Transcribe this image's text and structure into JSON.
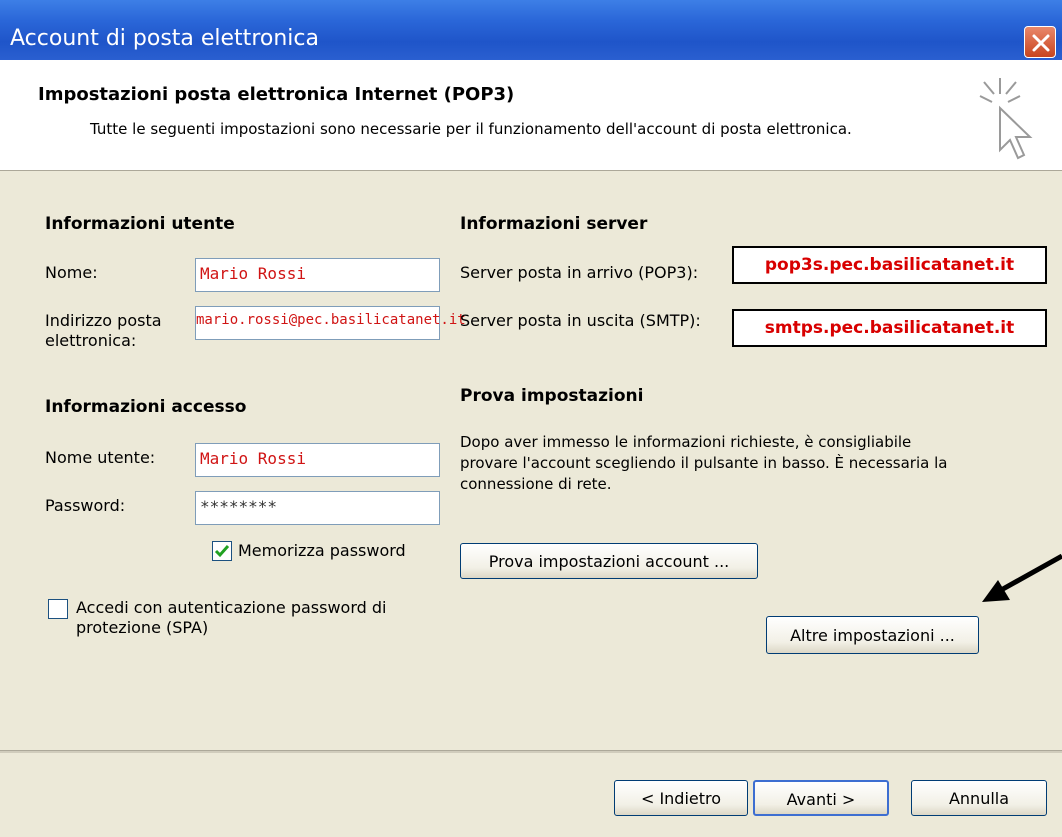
{
  "window": {
    "title": "Account di posta elettronica"
  },
  "header": {
    "title": "Impostazioni posta elettronica Internet (POP3)",
    "description": "Tutte le seguenti impostazioni sono necessarie per il funzionamento dell'account di posta elettronica."
  },
  "user_info": {
    "section_title": "Informazioni utente",
    "name_label": "Nome:",
    "name_value": "Mario Rossi",
    "email_label": "Indirizzo posta elettronica:",
    "email_value": "mario.rossi@pec.basilicatanet.it"
  },
  "server_info": {
    "section_title": "Informazioni server",
    "incoming_label": "Server posta in arrivo (POP3):",
    "incoming_value": "pop3s.pec.basilicatanet.it",
    "outgoing_label": "Server posta in uscita (SMTP):",
    "outgoing_value": "smtps.pec.basilicatanet.it"
  },
  "access_info": {
    "section_title": "Informazioni accesso",
    "username_label": "Nome utente:",
    "username_value": "Mario Rossi",
    "password_label": "Password:",
    "password_value": "********",
    "remember_label": "Memorizza password",
    "remember_checked": true,
    "spa_label": "Accedi con autenticazione password di protezione (SPA)",
    "spa_checked": false
  },
  "test": {
    "section_title": "Prova impostazioni",
    "description": "Dopo aver immesso le informazioni richieste, è consigliabile provare l'account scegliendo il pulsante in basso. È necessaria la connessione di rete.",
    "test_button": "Prova impostazioni account ...",
    "more_button": "Altre impostazioni ..."
  },
  "footer": {
    "back": "< Indietro",
    "next": "Avanti >",
    "cancel": "Annulla"
  }
}
